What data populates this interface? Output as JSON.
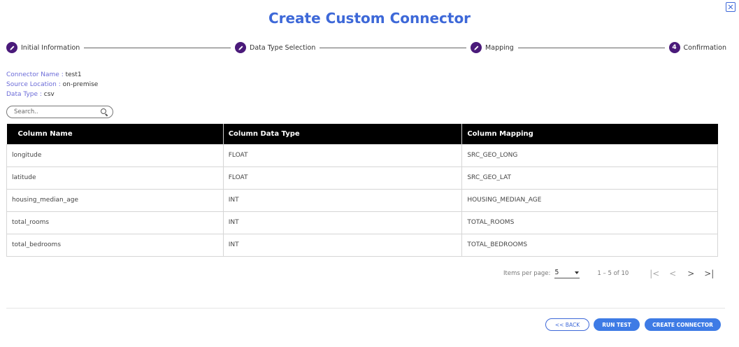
{
  "dialog": {
    "title": "Create Custom Connector",
    "close_icon": "close-icon"
  },
  "stepper": {
    "steps": [
      {
        "label": "Initial Information",
        "icon": "pencil-icon",
        "marker": ""
      },
      {
        "label": "Data Type Selection",
        "icon": "pencil-icon",
        "marker": ""
      },
      {
        "label": "Mapping",
        "icon": "pencil-icon",
        "marker": ""
      },
      {
        "label": "Confirmation",
        "icon": "step-number",
        "marker": "4"
      }
    ]
  },
  "info": {
    "connector_name_label": "Connector Name :",
    "connector_name_value": "test1",
    "source_location_label": "Source Location :",
    "source_location_value": "on-premise",
    "data_type_label": "Data Type :",
    "data_type_value": "csv"
  },
  "search": {
    "placeholder": "Search..",
    "value": ""
  },
  "table": {
    "headers": [
      "Column Name",
      "Column Data Type",
      "Column Mapping"
    ],
    "rows": [
      [
        "longitude",
        "FLOAT",
        "SRC_GEO_LONG"
      ],
      [
        "latitude",
        "FLOAT",
        "SRC_GEO_LAT"
      ],
      [
        "housing_median_age",
        "INT",
        "HOUSING_MEDIAN_AGE"
      ],
      [
        "total_rooms",
        "INT",
        "TOTAL_ROOMS"
      ],
      [
        "total_bedrooms",
        "INT",
        "TOTAL_BEDROOMS"
      ]
    ]
  },
  "paginator": {
    "items_per_page_label": "Items per page:",
    "items_per_page_value": "5",
    "range_label": "1 – 5 of 10",
    "first_glyph": "|<",
    "prev_glyph": "<",
    "next_glyph": ">",
    "last_glyph": ">|"
  },
  "footer": {
    "back_label": "<< BACK",
    "run_test_label": "RUN TEST",
    "create_label": "CREATE CONNECTOR"
  },
  "colors": {
    "accent": "#3d68d8",
    "step_icon": "#4a1a7a",
    "button": "#3e7be5"
  }
}
